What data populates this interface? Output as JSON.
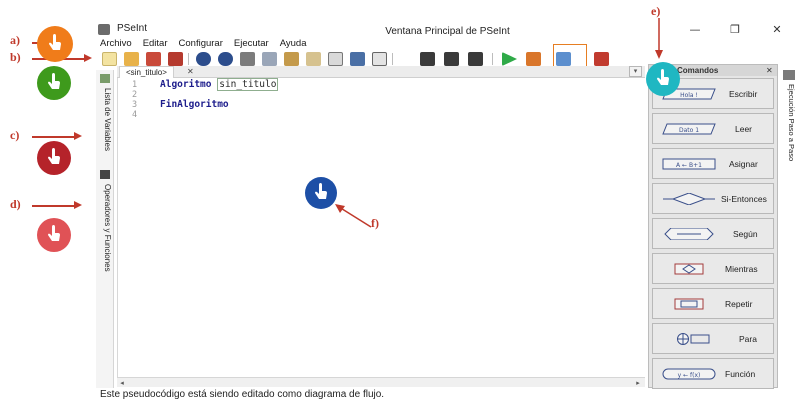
{
  "window": {
    "app_title": "PSeInt",
    "caption": "Ventana Principal de PSeInt",
    "minimize": "—",
    "maximize": "❐",
    "close": "✕"
  },
  "menu": [
    "Archivo",
    "Editar",
    "Configurar",
    "Ejecutar",
    "Ayuda"
  ],
  "left_tabs": {
    "variables": "Lista de Variables",
    "operators": "Operadores y Funciones"
  },
  "editor": {
    "tab_label": "<sin_titulo>",
    "tab_close": "✕",
    "dropdown": "▾",
    "line_numbers": [
      "1",
      "2",
      "3",
      "4"
    ],
    "lines": {
      "l1_keyword": "Algoritmo",
      "l1_name": "sin_titulo",
      "l3_keyword": "FinAlgoritmo"
    },
    "scroll_left": "◂",
    "scroll_right": "▸"
  },
  "commands_panel": {
    "title": "Comandos",
    "close": "✕",
    "items": [
      {
        "label": "Escribir",
        "shape": "Hola !"
      },
      {
        "label": "Leer",
        "shape": "Dato 1"
      },
      {
        "label": "Asignar",
        "shape": "A ← B+1"
      },
      {
        "label": "Si-Entonces",
        "shape": ""
      },
      {
        "label": "Según",
        "shape": ""
      },
      {
        "label": "Mientras",
        "shape": ""
      },
      {
        "label": "Repetir",
        "shape": ""
      },
      {
        "label": "Para",
        "shape": ""
      },
      {
        "label": "Función",
        "shape": "y ← f(x)"
      }
    ]
  },
  "right_tab": "Ejecución Paso a Paso",
  "status_bar": "Este pseudocódigo está siendo editado como diagrama de flujo.",
  "annotations": {
    "a": "a)",
    "b": "b)",
    "c": "c)",
    "d": "d)",
    "e": "e)",
    "f": "f)"
  },
  "colors": {
    "orange": "#f07c1a",
    "green": "#3e9a1c",
    "dark_red": "#b5232a",
    "light_red": "#e05256",
    "teal": "#1fb7c2",
    "blue": "#1d4fa6",
    "arrow": "#c0392b"
  }
}
